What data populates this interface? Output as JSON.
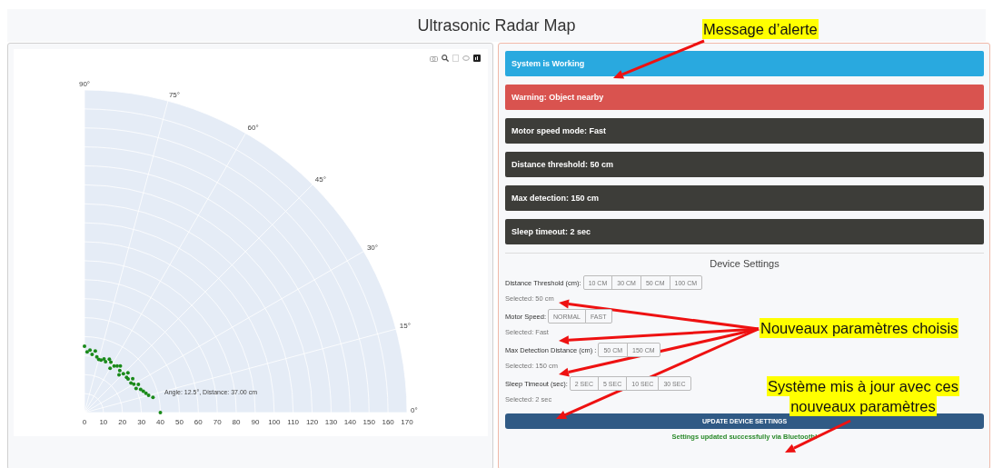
{
  "title": "Ultrasonic Radar Map",
  "radar": {
    "hover_label": "Angle: 12.5°, Distance: 37.00 cm",
    "angle_labels": [
      "0°",
      "15°",
      "30°",
      "45°",
      "60°",
      "75°",
      "90°"
    ],
    "distance_labels": [
      "0",
      "10",
      "20",
      "30",
      "40",
      "50",
      "60",
      "70",
      "80",
      "90",
      "100",
      "110",
      "120",
      "130",
      "140",
      "150",
      "160",
      "170"
    ]
  },
  "alerts": [
    {
      "text": "System is Working",
      "kind": "info"
    },
    {
      "text": "Warning: Object nearby",
      "kind": "danger"
    },
    {
      "text": "Motor speed mode: Fast",
      "kind": "dark"
    },
    {
      "text": "Distance threshold: 50 cm",
      "kind": "dark"
    },
    {
      "text": "Max detection: 150 cm",
      "kind": "dark"
    },
    {
      "text": "Sleep timeout: 2 sec",
      "kind": "dark"
    }
  ],
  "settings": {
    "title": "Device Settings",
    "rows": [
      {
        "label": "Distance Threshold (cm):",
        "options": [
          "10 CM",
          "30 CM",
          "50 CM",
          "100 CM"
        ],
        "selected_text": "Selected: 50 cm"
      },
      {
        "label": "Motor Speed:",
        "options": [
          "NORMAL",
          "FAST"
        ],
        "selected_text": "Selected: Fast"
      },
      {
        "label": "Max Detection Distance (cm) :",
        "options": [
          "50 CM",
          "150 CM"
        ],
        "selected_text": "Selected: 150 cm"
      },
      {
        "label": "Sleep Timeout (sec):",
        "options": [
          "2 SEC",
          "5 SEC",
          "10 SEC",
          "30 SEC"
        ],
        "selected_text": "Selected: 2 sec"
      }
    ],
    "button": "UPDATE DEVICE SETTINGS",
    "status": "Settings updated successfully via Bluetooth!"
  },
  "annotations": [
    {
      "lines": [
        "Message d’alerte"
      ]
    },
    {
      "lines": [
        "Nouveaux paramètres choisis"
      ]
    },
    {
      "lines": [
        "Système mis à jour avec ces",
        "nouveaux paramètres"
      ]
    }
  ]
}
